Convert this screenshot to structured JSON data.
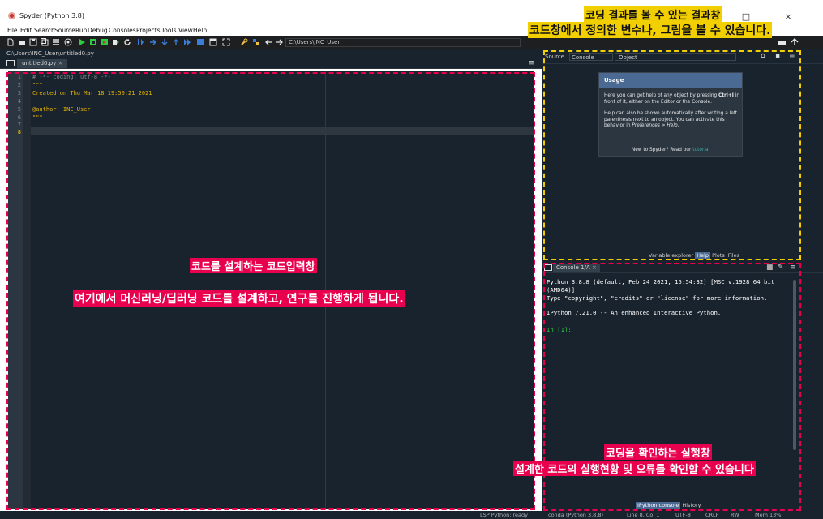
{
  "app": {
    "title": "Spyder (Python 3.8)",
    "window_controls": {
      "minimize": "—",
      "maximize": "□",
      "close": "×"
    }
  },
  "menubar": {
    "items": [
      "File",
      "Edit",
      "Search",
      "Source",
      "Run",
      "Debug",
      "Consoles",
      "Projects",
      "Tools",
      "View",
      "Help"
    ]
  },
  "toolbar": {
    "working_directory": "C:\\Users\\INC_User",
    "icons": [
      "new-file-icon",
      "open-folder-icon",
      "save-icon",
      "save-all-icon",
      "list-icon",
      "at-icon",
      "run-icon",
      "run-cell-icon",
      "run-cell-advance-icon",
      "run-selection-icon",
      "rerun-icon",
      "debug-icon",
      "step-icon",
      "step-into-icon",
      "step-return-icon",
      "continue-icon",
      "stop-debug-icon",
      "maximize-pane-icon",
      "fullscreen-icon",
      "wrench-icon",
      "python-path-icon",
      "back-arrow-icon",
      "forward-arrow-icon"
    ]
  },
  "editor": {
    "file_path": "C:\\Users\\INC_User\\untitled0.py",
    "tab_label": "untitled0.py",
    "tab_close": "×",
    "active_line": 8,
    "lines": [
      {
        "num": "1",
        "text": "# -*- coding: utf-8 -*-",
        "color": "#7f8c8d"
      },
      {
        "num": "2",
        "text": "\"\"\"",
        "color": "#e6b400"
      },
      {
        "num": "3",
        "text": "Created on Thu Mar 18 19:50:21 2021",
        "color": "#e6b400"
      },
      {
        "num": "4",
        "text": "",
        "color": "#e6b400"
      },
      {
        "num": "5",
        "text": "@author: INC_User",
        "color": "#e6b400"
      },
      {
        "num": "6",
        "text": "\"\"\"",
        "color": "#e6b400"
      },
      {
        "num": "7",
        "text": "",
        "color": "#e6b400"
      },
      {
        "num": "8",
        "text": "",
        "color": "#e6b400"
      }
    ]
  },
  "help_pane": {
    "source_label": "Source",
    "combo_value": "Console",
    "object_label": "Object",
    "usage_title": "Usage",
    "usage_p1_a": "Here you can get help of any object by pressing ",
    "usage_p1_key": "Ctrl+I",
    "usage_p1_b": " in front of it, either on the Editor or the Console.",
    "usage_p2_a": "Help can also be shown automatically after writing a left parenthesis next to an object. You can activate this behavior in ",
    "usage_p2_em": "Preferences > Help",
    "usage_p2_b": ".",
    "usage_foot": "New to Spyder? Read our ",
    "usage_link": "tutorial",
    "tabs": [
      "Variable explorer",
      "Help",
      "Plots",
      "Files"
    ],
    "selected_tab": "Help"
  },
  "console": {
    "tab_label": "Console 1/A",
    "tab_close": "×",
    "lines": [
      "Python 3.8.8 (default, Feb 24 2021, 15:54:32) [MSC v.1928 64 bit",
      "(AMD64)]",
      "Type \"copyright\", \"credits\" or \"license\" for more information.",
      "",
      "IPython 7.21.0 -- An enhanced Interactive Python.",
      "",
      "In [1]:"
    ],
    "tabs": [
      "IPython console",
      "History"
    ],
    "selected_tab": "IPython console"
  },
  "statusbar": {
    "lsp": "LSP Python: ready",
    "conda": "conda (Python 3.8.8)",
    "cursor": "Line 8, Col 1",
    "encoding": "UTF-8",
    "eol": "CRLF",
    "rw": "RW",
    "mem": "Mem 13%"
  },
  "annotations": {
    "editor_title": "코드를 설계하는 코드입력창",
    "editor_desc": "여기에서 머신러닝/딥러닝 코드를 설계하고, 연구를 진행하게 됩니다.",
    "help_title": "코딩 결과를 볼 수 있는 결과창",
    "help_desc": "코드창에서 정의한 변수나, 그림을 볼 수 있습니다.",
    "console_title": "코딩을 확인하는 실행창",
    "console_desc": "설계한 코드의 실행현황 및 오류를 확인할 수 있습니다",
    "colors": {
      "red": "#e8004f",
      "yellow": "#f2cf00"
    }
  }
}
